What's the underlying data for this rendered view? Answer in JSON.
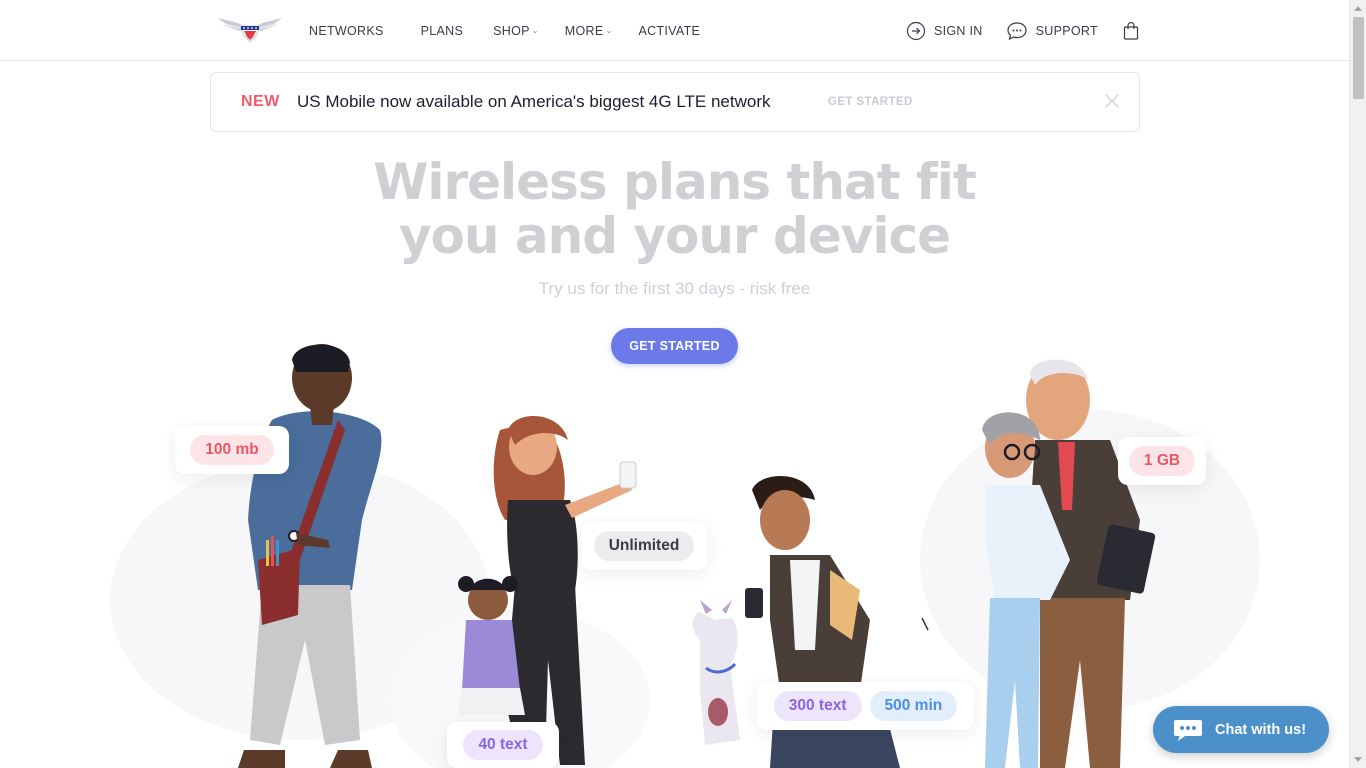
{
  "header": {
    "logo_alt": "US Mobile",
    "nav_left": [
      {
        "label": "NETWORKS"
      },
      {
        "label": "PLANS"
      },
      {
        "label": "SHOP",
        "dropdown": true
      },
      {
        "label": "MORE",
        "dropdown": true
      },
      {
        "label": "ACTIVATE"
      }
    ],
    "sign_in": "SIGN IN",
    "support": "SUPPORT",
    "icons": [
      "sign-in-icon",
      "support-chat-icon",
      "shopping-bag-icon"
    ]
  },
  "banner": {
    "badge": "NEW",
    "message": "US Mobile now available on America's biggest 4G LTE network",
    "cta": "GET STARTED",
    "colors": {
      "badge": "#f25a6a"
    }
  },
  "hero": {
    "title_line1": "Wireless plans that fit",
    "title_line2": "you and your device",
    "subtitle": "Try us for the first 30 days - risk free",
    "button": "GET STARTED",
    "colors": {
      "button": "#6b7ae8"
    }
  },
  "bubbles": {
    "data_100mb": "100 mb",
    "unlimited": "Unlimited",
    "text_40": "40 text",
    "text_300": "300 text",
    "min_500": "500 min",
    "data_1gb": "1 GB"
  },
  "chat": {
    "label": "Chat with us!",
    "color": "#4b90c8"
  }
}
